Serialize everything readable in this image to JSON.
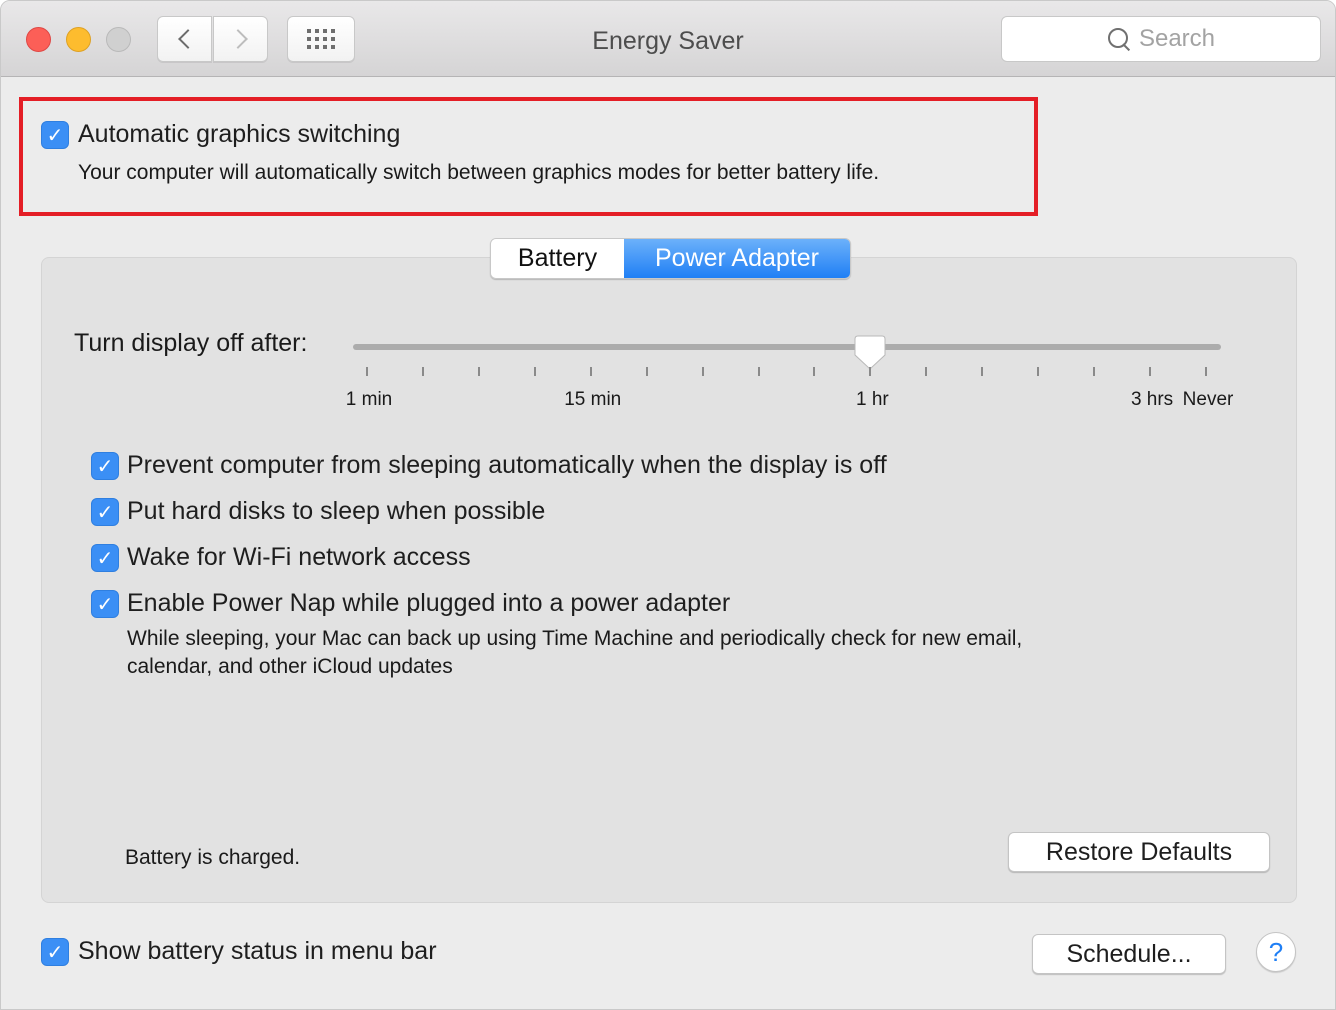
{
  "window": {
    "title": "Energy Saver",
    "traffic_lights": [
      "close",
      "minimize",
      "zoom"
    ]
  },
  "toolbar": {
    "back_icon": "chevron-left-icon",
    "forward_icon": "chevron-right-icon",
    "show_all_icon": "grid-icon",
    "search": {
      "placeholder": "Search",
      "value": "",
      "icon": "magnifying-glass-icon"
    }
  },
  "graphics_switching": {
    "checked": true,
    "label": "Automatic graphics switching",
    "description": "Your computer will automatically switch between graphics modes for better battery life.",
    "highlight_color": "#e41e26"
  },
  "tabs": [
    {
      "label": "Battery",
      "selected": false
    },
    {
      "label": "Power Adapter",
      "selected": true
    }
  ],
  "display_sleep": {
    "label": "Turn display off after:",
    "tick_count": 16,
    "selected_tick_index": 9,
    "selected_value": "1 hr",
    "tick_labels": [
      {
        "text": "1 min",
        "tick": 0
      },
      {
        "text": "15 min",
        "tick": 4
      },
      {
        "text": "1 hr",
        "tick": 9
      },
      {
        "text": "3 hrs",
        "tick": 14
      },
      {
        "text": "Never",
        "tick": 15
      }
    ]
  },
  "options": [
    {
      "label": "Prevent computer from sleeping automatically when the display is off",
      "checked": true
    },
    {
      "label": "Put hard disks to sleep when possible",
      "checked": true
    },
    {
      "label": "Wake for Wi-Fi network access",
      "checked": true
    },
    {
      "label": "Enable Power Nap while plugged into a power adapter",
      "checked": true,
      "description_lines": [
        "While sleeping, your Mac can back up using Time Machine and periodically check for new email,",
        "calendar, and other iCloud updates"
      ]
    }
  ],
  "status": "Battery is charged.",
  "buttons": {
    "restore_defaults": "Restore Defaults",
    "schedule": "Schedule...",
    "help": "?"
  },
  "show_battery_status": {
    "label": "Show battery status in menu bar",
    "checked": true
  },
  "colors": {
    "accent": "#3b8ff5",
    "checkbox_mark": "#ffffff"
  }
}
